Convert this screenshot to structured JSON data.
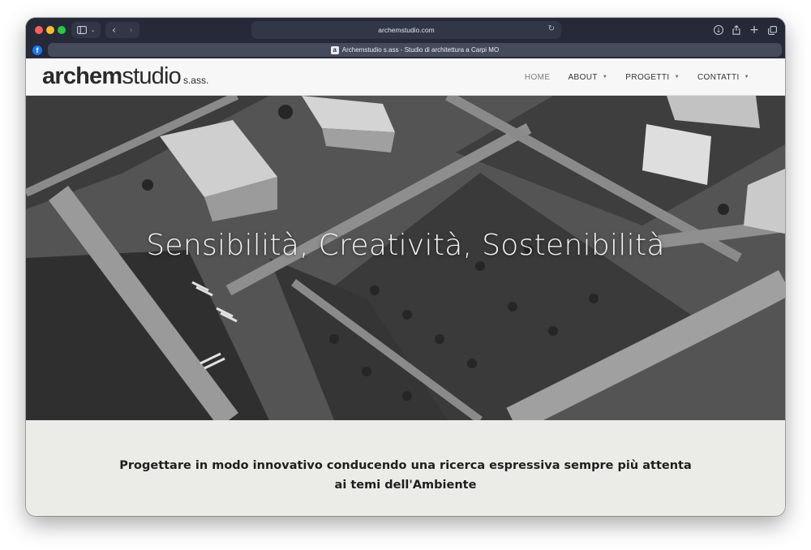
{
  "browser": {
    "address": "archemstudio.com",
    "tab_title": "Archemstudio s.ass - Studio di architettura a Carpi MO",
    "tab_favicon_letter": "a",
    "pinned_favicon_letter": "f",
    "colors": {
      "chrome": "#252938",
      "close": "#ff5f57",
      "minimize": "#febc2e",
      "zoom": "#28c840"
    }
  },
  "site": {
    "logo": {
      "bold": "archem",
      "regular": "studio",
      "suffix": "s.ass."
    },
    "nav": [
      {
        "label": "HOME",
        "active": true
      },
      {
        "label": "ABOUT",
        "has_dropdown": true
      },
      {
        "label": "PROGETTI",
        "has_dropdown": true
      },
      {
        "label": "CONTATTI",
        "has_dropdown": true
      }
    ],
    "hero_title": "Sensibilità, Creatività, Sostenibilità",
    "intro_text": "Progettare in modo innovativo conducendo una ricerca espressiva sempre più attenta ai temi dell'Ambiente",
    "colors": {
      "header_bg": "#f7f7f7",
      "intro_bg": "#ebebe8",
      "text": "#1e1e1e"
    }
  }
}
